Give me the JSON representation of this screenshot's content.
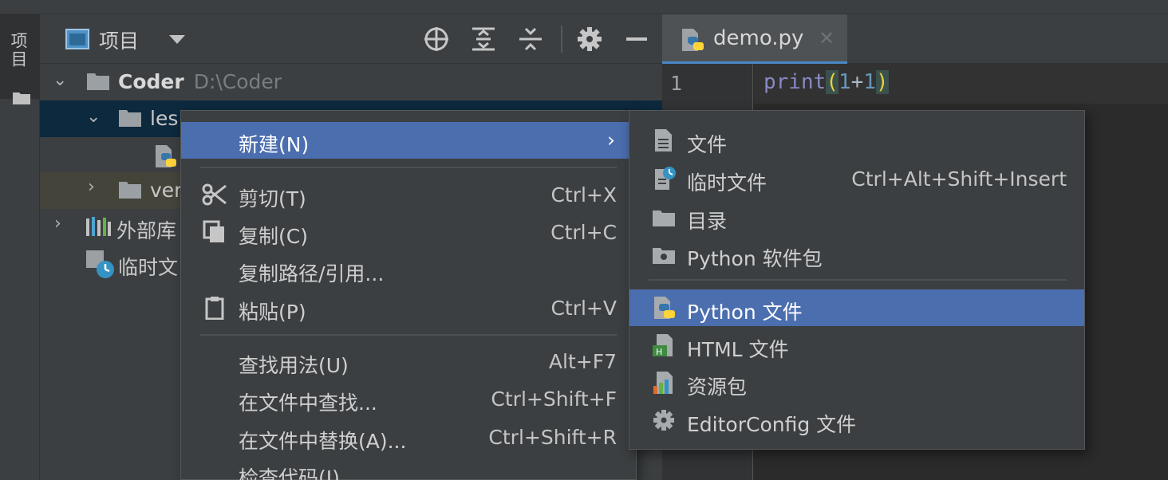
{
  "left_strip": {
    "tab_label": "项目"
  },
  "project_panel": {
    "title": "项目"
  },
  "editor_tab": {
    "filename": "demo.py",
    "close_glyph": "✕"
  },
  "tree": {
    "root": {
      "name": "Coder",
      "path": "D:\\Coder"
    },
    "lessons": {
      "name": "les"
    },
    "venv": {
      "name": "ver"
    },
    "external": {
      "name": "外部库"
    },
    "scratch": {
      "name": "临时文"
    }
  },
  "editor": {
    "line_number": "1",
    "code": {
      "keyword": "print",
      "open": "(",
      "num1": "1",
      "op": "+",
      "num2": "1",
      "close": ")"
    }
  },
  "context_menu": {
    "new": {
      "label": "新建(N)"
    },
    "cut": {
      "label": "剪切(T)",
      "shortcut": "Ctrl+X"
    },
    "copy": {
      "label": "复制(C)",
      "shortcut": "Ctrl+C"
    },
    "copy_path": {
      "label": "复制路径/引用..."
    },
    "paste": {
      "label": "粘贴(P)",
      "shortcut": "Ctrl+V"
    },
    "find_usages": {
      "label": "查找用法(U)",
      "shortcut": "Alt+F7"
    },
    "find_in_files": {
      "label": "在文件中查找...",
      "shortcut": "Ctrl+Shift+F"
    },
    "replace_in_files": {
      "label": "在文件中替换(A)...",
      "shortcut": "Ctrl+Shift+R"
    },
    "inspect_code": {
      "label": "检查代码(I)..."
    }
  },
  "submenu": {
    "file": {
      "label": "文件"
    },
    "scratch_file": {
      "label": "临时文件",
      "shortcut": "Ctrl+Alt+Shift+Insert"
    },
    "directory": {
      "label": "目录"
    },
    "python_package": {
      "label": "Python 软件包"
    },
    "python_file": {
      "label": "Python 文件"
    },
    "html_file": {
      "label": "HTML 文件"
    },
    "resource_bundle": {
      "label": "资源包"
    },
    "editorconfig_file": {
      "label": "EditorConfig 文件"
    }
  },
  "colors": {
    "selection": "#4b6eaf",
    "tree_selection": "#0d293e",
    "panel_bg": "#3c3f41",
    "editor_bg": "#2b2b2b",
    "python_blue": "#3776ab",
    "python_yellow": "#ffd43b"
  },
  "icons": {
    "project_view": "project-view-icon",
    "locate": "locate-crosshair-icon",
    "expand_all": "expand-all-icon",
    "collapse_all": "collapse-all-icon",
    "settings": "gear-icon",
    "hide": "minimize-icon",
    "python": "python-file-icon",
    "folder": "folder-icon",
    "library": "library-icon",
    "scratch": "scratch-icon",
    "cut": "scissors-icon",
    "copy": "copy-icon",
    "paste": "clipboard-icon",
    "file": "file-icon",
    "package": "package-icon",
    "html": "html-file-icon",
    "resource": "resource-bundle-icon"
  }
}
